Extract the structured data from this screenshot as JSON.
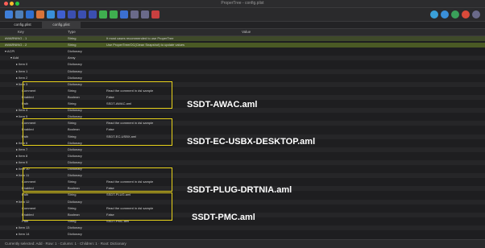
{
  "window": {
    "title": "ProperTree - config.plist"
  },
  "toolbar": {
    "buttons": [
      {
        "name": "app-icon",
        "color": "#3f7fd9"
      },
      {
        "name": "folder-icon",
        "color": "#4f7fb8"
      },
      {
        "name": "save-icon",
        "color": "#2f6fd0"
      },
      {
        "name": "user-icon",
        "color": "#d9743a"
      },
      {
        "name": "globe-icon",
        "color": "#3a8fd9"
      },
      {
        "name": "gear-icon",
        "color": "#3f5fcf"
      },
      {
        "name": "square-icon",
        "color": "#3b4fb0"
      },
      {
        "name": "grid-icon",
        "color": "#3b4fb0"
      },
      {
        "name": "list-icon",
        "color": "#3b4fb0"
      },
      {
        "name": "circle-green-icon",
        "color": "#3fae4f"
      },
      {
        "name": "circle-green-icon-2",
        "color": "#3fae4f"
      },
      {
        "name": "circle-blue-icon",
        "color": "#3b6fd0"
      },
      {
        "name": "arrow-icon",
        "color": "#6a6a8a"
      },
      {
        "name": "arrow-icon-2",
        "color": "#6a6a8a"
      },
      {
        "name": "red-square-icon",
        "color": "#c84040"
      }
    ],
    "right_buttons": [
      {
        "name": "share-icon",
        "color": "#3aa0d9"
      },
      {
        "name": "search-icon",
        "color": "#3a8fd9"
      },
      {
        "name": "info-icon",
        "color": "#3aa05a"
      },
      {
        "name": "alert-icon",
        "color": "#d94a3a"
      },
      {
        "name": "bell-icon",
        "color": "#6a6a8a"
      }
    ]
  },
  "tabs": [
    {
      "label": "config.plist",
      "active": false
    },
    {
      "label": "config.plist",
      "active": true
    }
  ],
  "header": {
    "key": "Key",
    "type": "Type",
    "value": "Value"
  },
  "rows": [
    {
      "indent": 0,
      "key": "#WARNING - 1",
      "type": "String",
      "value": "It most cases recommended to use ProperTree",
      "style": "hl-a"
    },
    {
      "indent": 0,
      "key": "#WARNING - 2",
      "type": "String",
      "value": "Use ProperTree/OC(Clean Snapshot) to update values",
      "style": "hl-b"
    },
    {
      "indent": 0,
      "key": "▾ ACPI",
      "type": "Dictionary",
      "value": "",
      "style": ""
    },
    {
      "indent": 1,
      "key": "▾ Add",
      "type": "Array",
      "value": "",
      "style": "alt"
    },
    {
      "indent": 2,
      "key": "▸ Item 0",
      "type": "Dictionary",
      "value": "",
      "style": ""
    },
    {
      "indent": 2,
      "key": "▸ Item 1",
      "type": "Dictionary",
      "value": "",
      "style": "alt"
    },
    {
      "indent": 2,
      "key": "▸ Item 2",
      "type": "Dictionary",
      "value": "",
      "style": ""
    },
    {
      "indent": 2,
      "key": "▾ Item 3",
      "type": "Dictionary",
      "value": "",
      "style": "alt"
    },
    {
      "indent": 3,
      "key": "Comment",
      "type": "String",
      "value": "Read the comment in dsl sample",
      "style": ""
    },
    {
      "indent": 3,
      "key": "Enabled",
      "type": "Boolean",
      "value": "False",
      "style": "alt"
    },
    {
      "indent": 3,
      "key": "Path",
      "type": "String",
      "value": "SSDT-AWAC.aml",
      "style": ""
    },
    {
      "indent": 2,
      "key": "▸ Item 4",
      "type": "Dictionary",
      "value": "",
      "style": "alt"
    },
    {
      "indent": 2,
      "key": "▾ Item 5",
      "type": "Dictionary",
      "value": "",
      "style": ""
    },
    {
      "indent": 3,
      "key": "Comment",
      "type": "String",
      "value": "Read the comment in dsl sample",
      "style": "alt"
    },
    {
      "indent": 3,
      "key": "Enabled",
      "type": "Boolean",
      "value": "False",
      "style": ""
    },
    {
      "indent": 3,
      "key": "Path",
      "type": "String",
      "value": "SSDT-EC-USBX.aml",
      "style": "alt"
    },
    {
      "indent": 2,
      "key": "▸ Item 6",
      "type": "Dictionary",
      "value": "",
      "style": ""
    },
    {
      "indent": 2,
      "key": "▸ Item 7",
      "type": "Dictionary",
      "value": "",
      "style": "alt"
    },
    {
      "indent": 2,
      "key": "▸ Item 8",
      "type": "Dictionary",
      "value": "",
      "style": ""
    },
    {
      "indent": 2,
      "key": "▸ Item 9",
      "type": "Dictionary",
      "value": "",
      "style": "alt"
    },
    {
      "indent": 2,
      "key": "▸ Item 10",
      "type": "Dictionary",
      "value": "",
      "style": ""
    },
    {
      "indent": 2,
      "key": "▾ Item 11",
      "type": "Dictionary",
      "value": "",
      "style": "alt"
    },
    {
      "indent": 3,
      "key": "Comment",
      "type": "String",
      "value": "Read the comment in dsl sample",
      "style": ""
    },
    {
      "indent": 3,
      "key": "Enabled",
      "type": "Boolean",
      "value": "False",
      "style": "alt"
    },
    {
      "indent": 3,
      "key": "Path",
      "type": "String",
      "value": "SSDT-PLUG.aml",
      "style": ""
    },
    {
      "indent": 2,
      "key": "▾ Item 12",
      "type": "Dictionary",
      "value": "",
      "style": "alt"
    },
    {
      "indent": 3,
      "key": "Comment",
      "type": "String",
      "value": "Read the comment in dsl sample",
      "style": ""
    },
    {
      "indent": 3,
      "key": "Enabled",
      "type": "Boolean",
      "value": "False",
      "style": "alt"
    },
    {
      "indent": 3,
      "key": "Path",
      "type": "String",
      "value": "SSDT-PMC.aml",
      "style": ""
    },
    {
      "indent": 2,
      "key": "▸ Item 13",
      "type": "Dictionary",
      "value": "",
      "style": "alt"
    },
    {
      "indent": 2,
      "key": "▸ Item 14",
      "type": "Dictionary",
      "value": "",
      "style": ""
    }
  ],
  "annotations": [
    {
      "label": "SSDT-AWAC.aml"
    },
    {
      "label": "SSDT-EC-USBX-DESKTOP.aml"
    },
    {
      "label": "SSDT-PLUG-DRTNIA.aml"
    },
    {
      "label": "SSDT-PMC.aml"
    }
  ],
  "status": {
    "text": "Currently selected: Add  ·  Row: 1  ·  Column: 1  ·  Children: 1  ·  Root: Dictionary"
  },
  "colors": {
    "annotation_box": "#e8d21a",
    "warning_row_1": "#3f4a2a",
    "warning_row_2": "#4a5a24"
  }
}
